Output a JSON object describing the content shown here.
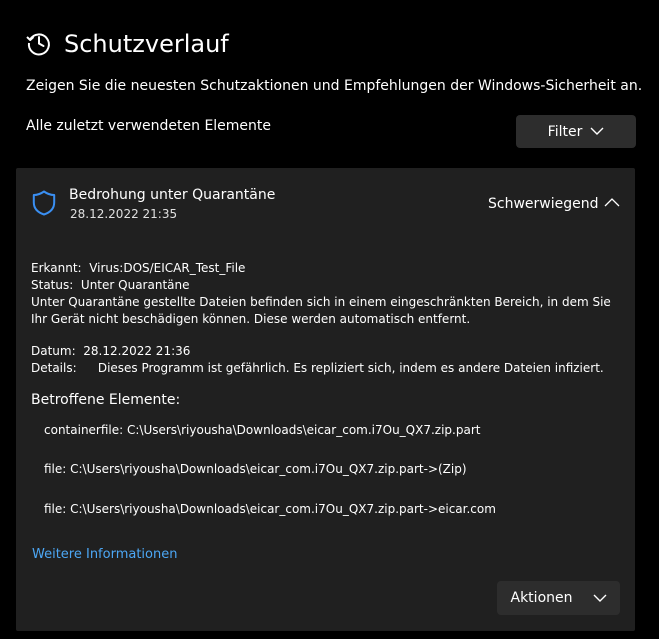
{
  "header": {
    "icon": "history-icon",
    "title": "Schutzverlauf",
    "description": "Zeigen Sie die neuesten Schutzaktionen und Empfehlungen der Windows-Sicherheit an."
  },
  "section_label": "Alle zuletzt verwendeten Elemente",
  "filter_button": {
    "label": "Filter",
    "icon": "chevron-down-icon"
  },
  "card": {
    "icon": "shield-icon",
    "title": "Bedrohung unter Quarantäne",
    "timestamp": "28.12.2022 21:35",
    "severity": "Schwerwiegend",
    "collapse_icon": "chevron-up-icon",
    "detected_label": "Erkannt:",
    "detected_value": "Virus:DOS/EICAR_Test_File",
    "status_label": "Status:",
    "status_value": "Unter Quarantäne",
    "status_message": "Unter Quarantäne gestellte Dateien befinden sich in einem eingeschränkten Bereich, in dem Sie Ihr Gerät nicht beschädigen können. Diese werden automatisch entfernt.",
    "date_label": "Datum:",
    "date_value": "28.12.2022 21:36",
    "details_label": "Details:",
    "details_value": "Dieses Programm ist gefährlich. Es repliziert sich, indem es andere Dateien infiziert.",
    "affected_heading": "Betroffene Elemente:",
    "affected_items": [
      "containerfile: C:\\Users\\riyousha\\Downloads\\eicar_com.i7Ou_QX7.zip.part",
      "file: C:\\Users\\riyousha\\Downloads\\eicar_com.i7Ou_QX7.zip.part->(Zip)",
      "file: C:\\Users\\riyousha\\Downloads\\eicar_com.i7Ou_QX7.zip.part->eicar.com"
    ],
    "more_info_link": "Weitere Informationen",
    "actions_button": {
      "label": "Aktionen",
      "icon": "chevron-down-icon"
    }
  },
  "colors": {
    "background": "#000000",
    "card": "#202020",
    "button": "#2d2d2d",
    "link": "#4ca7f5",
    "shield": "#3a8ff2"
  }
}
